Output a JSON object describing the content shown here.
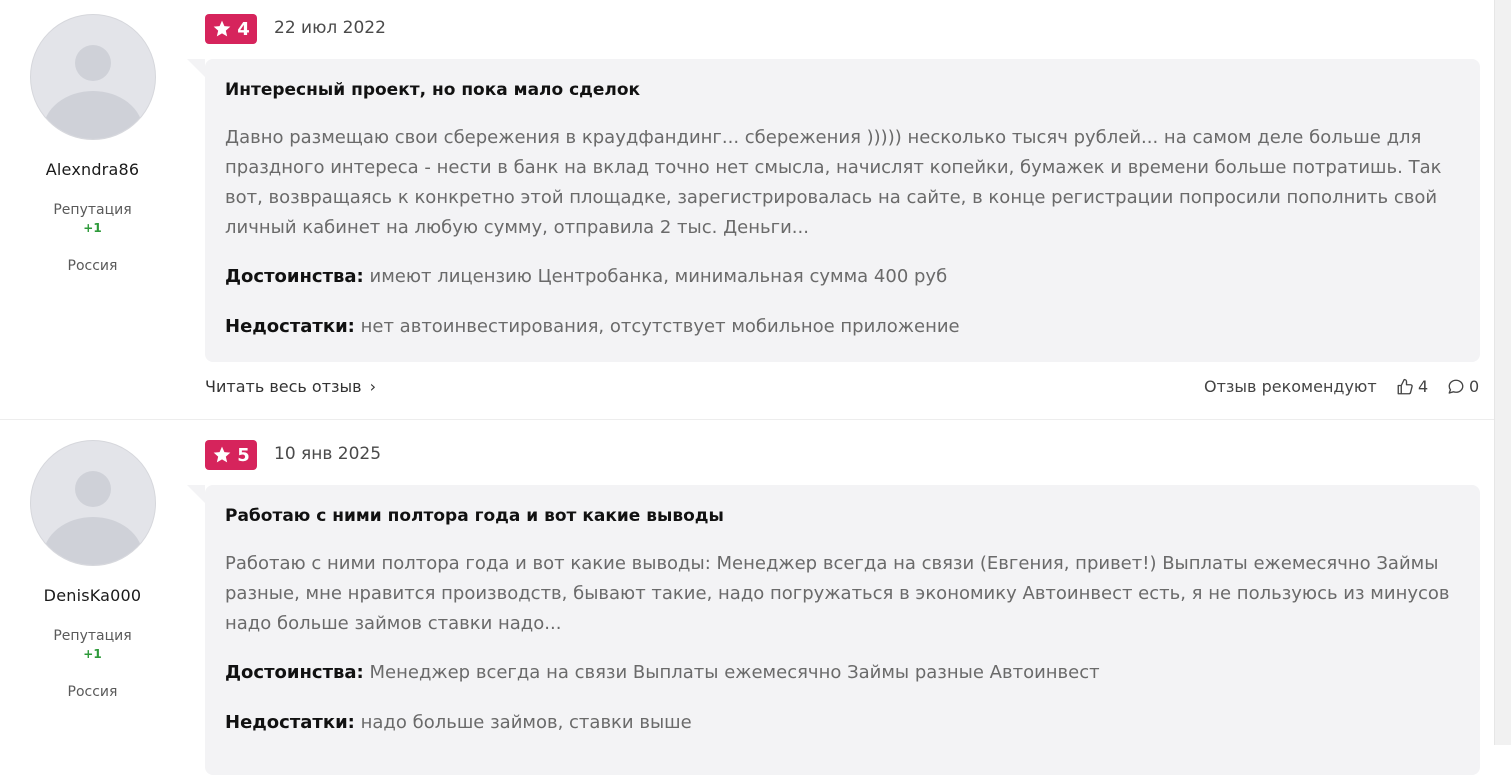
{
  "colors": {
    "rating_bg": "#d6245c",
    "reputation": "#2e9a3a",
    "bubble_bg": "#f3f3f5"
  },
  "reviews": [
    {
      "author": {
        "name": "Alexndra86",
        "reputation_label": "Репутация",
        "reputation": "+1",
        "country": "Россия"
      },
      "rating": "4",
      "date": "22 июл 2022",
      "title": "Интересный проект, но пока мало сделок",
      "text": "Давно размещаю свои сбережения в краудфандинг... сбережения ))))) несколько тысяч рублей... на самом деле больше для праздного интереса - нести в банк на вклад точно нет смысла, начислят копейки, бумажек и времени больше потратишь. Так вот, возвращаясь к конкретно этой площадке, зарегистрировалась на сайте, в конце регистрации попросили пополнить свой личный кабинет на любую сумму, отправила 2 тыс. Деньги...",
      "pros_label": "Достоинства:",
      "pros": "имеют лицензию Центробанка, минимальная сумма 400 руб",
      "cons_label": "Недостатки:",
      "cons": "нет автоинвестирования, отсутствует мобильное приложение",
      "read_more": "Читать весь отзыв",
      "recommend_label": "Отзыв рекомендуют",
      "likes": "4",
      "comments": "0"
    },
    {
      "author": {
        "name": "DenisKa000",
        "reputation_label": "Репутация",
        "reputation": "+1",
        "country": "Россия"
      },
      "rating": "5",
      "date": "10 янв 2025",
      "title": "Работаю с ними полтора года и вот какие выводы",
      "text": "Работаю с ними полтора года и вот какие выводы: Менеджер всегда на связи (Евгения, привет!) Выплаты ежемесячно Займы разные, мне нравится производств, бывают такие, надо погружаться в экономику Автоинвест есть, я не пользуюсь из минусов надо больше займов ставки надо...",
      "pros_label": "Достоинства:",
      "pros": "Менеджер всегда на связи Выплаты ежемесячно Займы разные Автоинвест",
      "cons_label": "Недостатки:",
      "cons": "надо больше займов, ставки выше"
    }
  ]
}
